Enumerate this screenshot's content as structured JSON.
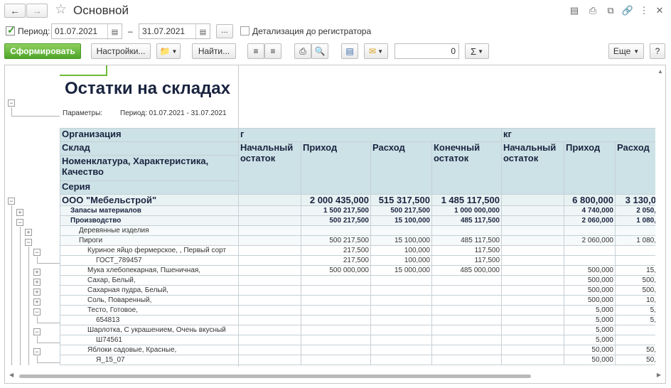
{
  "window": {
    "title": "Основной"
  },
  "period": {
    "checkbox_label": "Период:",
    "from": "01.07.2021",
    "dash": "–",
    "to": "31.07.2021",
    "dots": "...",
    "detail_label": "Детализация до регистратора"
  },
  "toolbar": {
    "generate": "Сформировать",
    "settings": "Настройки...",
    "find": "Найти...",
    "sum_value": "0",
    "more": "Еще",
    "help": "?"
  },
  "report": {
    "title": "Остатки на складах",
    "params_label": "Параметры:",
    "params_value": "Период: 01.07.2021 - 31.07.2021",
    "headers": {
      "org": "Организация",
      "warehouse": "Склад",
      "nomenclature": "Номенклатура, Характеристика, Качество",
      "series": "Серия",
      "unit_g": "г",
      "unit_kg": "кг",
      "start": "Начальный остаток",
      "income": "Приход",
      "expense": "Расход",
      "end": "Конечный остаток",
      "start2": "Начальный остаток",
      "income2": "Приход",
      "expense2": "Расход"
    },
    "rows": [
      {
        "name": "ООО \"Мебельстрой\"",
        "c1": "",
        "c2": "2 000 435,000",
        "c3": "515 317,500",
        "c4": "1 485 117,500",
        "c5": "",
        "c6": "6 800,000",
        "c7": "3 130,0"
      },
      {
        "name": "Запасы материалов",
        "c1": "",
        "c2": "1 500 217,500",
        "c3": "500 217,500",
        "c4": "1 000 000,000",
        "c5": "",
        "c6": "4 740,000",
        "c7": "2 050,"
      },
      {
        "name": "Производство",
        "c1": "",
        "c2": "500 217,500",
        "c3": "15 100,000",
        "c4": "485 117,500",
        "c5": "",
        "c6": "2 060,000",
        "c7": "1 080,"
      },
      {
        "name": "Деревянные изделия",
        "c1": "",
        "c2": "",
        "c3": "",
        "c4": "",
        "c5": "",
        "c6": "",
        "c7": ""
      },
      {
        "name": "Пироги",
        "c1": "",
        "c2": "500 217,500",
        "c3": "15 100,000",
        "c4": "485 117,500",
        "c5": "",
        "c6": "2 060,000",
        "c7": "1 080,"
      },
      {
        "name": "Куриное яйцо фермерское, , Первый сорт",
        "c1": "",
        "c2": "217,500",
        "c3": "100,000",
        "c4": "117,500",
        "c5": "",
        "c6": "",
        "c7": ""
      },
      {
        "name": "ГОСТ_789457",
        "c1": "",
        "c2": "217,500",
        "c3": "100,000",
        "c4": "117,500",
        "c5": "",
        "c6": "",
        "c7": ""
      },
      {
        "name": "Мука хлебопекарная, Пшеничная,",
        "c1": "",
        "c2": "500 000,000",
        "c3": "15 000,000",
        "c4": "485 000,000",
        "c5": "",
        "c6": "500,000",
        "c7": "15,"
      },
      {
        "name": "Сахар, Белый,",
        "c1": "",
        "c2": "",
        "c3": "",
        "c4": "",
        "c5": "",
        "c6": "500,000",
        "c7": "500,"
      },
      {
        "name": "Сахарная пудра, Белый,",
        "c1": "",
        "c2": "",
        "c3": "",
        "c4": "",
        "c5": "",
        "c6": "500,000",
        "c7": "500,"
      },
      {
        "name": "Соль, Поваренный,",
        "c1": "",
        "c2": "",
        "c3": "",
        "c4": "",
        "c5": "",
        "c6": "500,000",
        "c7": "10,"
      },
      {
        "name": "Тесто, Готовое,",
        "c1": "",
        "c2": "",
        "c3": "",
        "c4": "",
        "c5": "",
        "c6": "5,000",
        "c7": "5,"
      },
      {
        "name": "654813",
        "c1": "",
        "c2": "",
        "c3": "",
        "c4": "",
        "c5": "",
        "c6": "5,000",
        "c7": "5,"
      },
      {
        "name": "Шарлотка, С украшением, Очень вкусный",
        "c1": "",
        "c2": "",
        "c3": "",
        "c4": "",
        "c5": "",
        "c6": "5,000",
        "c7": ""
      },
      {
        "name": "Ш74561",
        "c1": "",
        "c2": "",
        "c3": "",
        "c4": "",
        "c5": "",
        "c6": "5,000",
        "c7": ""
      },
      {
        "name": "Яблоки садовые, Красные,",
        "c1": "",
        "c2": "",
        "c3": "",
        "c4": "",
        "c5": "",
        "c6": "50,000",
        "c7": "50,"
      },
      {
        "name": "Я_15_07",
        "c1": "",
        "c2": "",
        "c3": "",
        "c4": "",
        "c5": "",
        "c6": "50,000",
        "c7": "50,"
      }
    ]
  }
}
